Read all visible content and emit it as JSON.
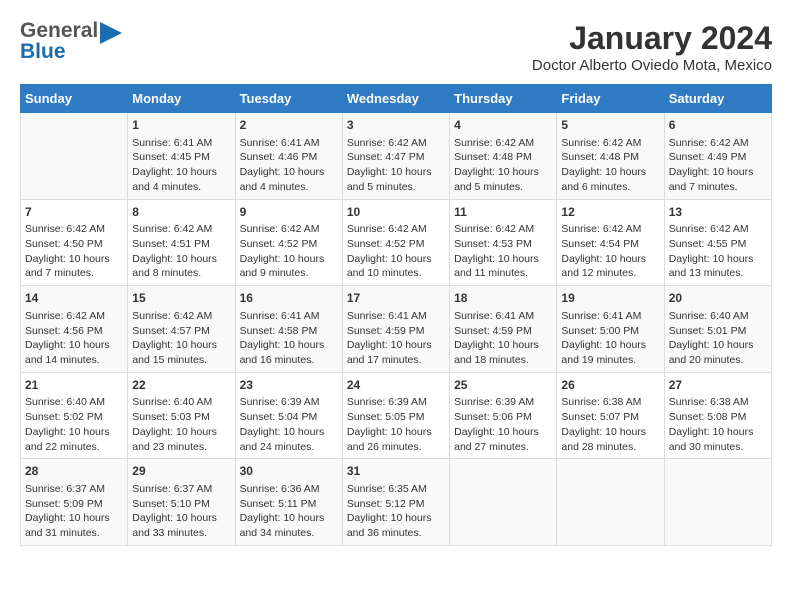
{
  "header": {
    "logo_general": "General",
    "logo_blue": "Blue",
    "title": "January 2024",
    "subtitle": "Doctor Alberto Oviedo Mota, Mexico"
  },
  "days_header": [
    "Sunday",
    "Monday",
    "Tuesday",
    "Wednesday",
    "Thursday",
    "Friday",
    "Saturday"
  ],
  "weeks": [
    [
      {
        "day": "",
        "sunrise": "",
        "sunset": "",
        "daylight": ""
      },
      {
        "day": "1",
        "sunrise": "Sunrise: 6:41 AM",
        "sunset": "Sunset: 4:45 PM",
        "daylight": "Daylight: 10 hours and 4 minutes."
      },
      {
        "day": "2",
        "sunrise": "Sunrise: 6:41 AM",
        "sunset": "Sunset: 4:46 PM",
        "daylight": "Daylight: 10 hours and 4 minutes."
      },
      {
        "day": "3",
        "sunrise": "Sunrise: 6:42 AM",
        "sunset": "Sunset: 4:47 PM",
        "daylight": "Daylight: 10 hours and 5 minutes."
      },
      {
        "day": "4",
        "sunrise": "Sunrise: 6:42 AM",
        "sunset": "Sunset: 4:48 PM",
        "daylight": "Daylight: 10 hours and 5 minutes."
      },
      {
        "day": "5",
        "sunrise": "Sunrise: 6:42 AM",
        "sunset": "Sunset: 4:48 PM",
        "daylight": "Daylight: 10 hours and 6 minutes."
      },
      {
        "day": "6",
        "sunrise": "Sunrise: 6:42 AM",
        "sunset": "Sunset: 4:49 PM",
        "daylight": "Daylight: 10 hours and 7 minutes."
      }
    ],
    [
      {
        "day": "7",
        "sunrise": "Sunrise: 6:42 AM",
        "sunset": "Sunset: 4:50 PM",
        "daylight": "Daylight: 10 hours and 7 minutes."
      },
      {
        "day": "8",
        "sunrise": "Sunrise: 6:42 AM",
        "sunset": "Sunset: 4:51 PM",
        "daylight": "Daylight: 10 hours and 8 minutes."
      },
      {
        "day": "9",
        "sunrise": "Sunrise: 6:42 AM",
        "sunset": "Sunset: 4:52 PM",
        "daylight": "Daylight: 10 hours and 9 minutes."
      },
      {
        "day": "10",
        "sunrise": "Sunrise: 6:42 AM",
        "sunset": "Sunset: 4:52 PM",
        "daylight": "Daylight: 10 hours and 10 minutes."
      },
      {
        "day": "11",
        "sunrise": "Sunrise: 6:42 AM",
        "sunset": "Sunset: 4:53 PM",
        "daylight": "Daylight: 10 hours and 11 minutes."
      },
      {
        "day": "12",
        "sunrise": "Sunrise: 6:42 AM",
        "sunset": "Sunset: 4:54 PM",
        "daylight": "Daylight: 10 hours and 12 minutes."
      },
      {
        "day": "13",
        "sunrise": "Sunrise: 6:42 AM",
        "sunset": "Sunset: 4:55 PM",
        "daylight": "Daylight: 10 hours and 13 minutes."
      }
    ],
    [
      {
        "day": "14",
        "sunrise": "Sunrise: 6:42 AM",
        "sunset": "Sunset: 4:56 PM",
        "daylight": "Daylight: 10 hours and 14 minutes."
      },
      {
        "day": "15",
        "sunrise": "Sunrise: 6:42 AM",
        "sunset": "Sunset: 4:57 PM",
        "daylight": "Daylight: 10 hours and 15 minutes."
      },
      {
        "day": "16",
        "sunrise": "Sunrise: 6:41 AM",
        "sunset": "Sunset: 4:58 PM",
        "daylight": "Daylight: 10 hours and 16 minutes."
      },
      {
        "day": "17",
        "sunrise": "Sunrise: 6:41 AM",
        "sunset": "Sunset: 4:59 PM",
        "daylight": "Daylight: 10 hours and 17 minutes."
      },
      {
        "day": "18",
        "sunrise": "Sunrise: 6:41 AM",
        "sunset": "Sunset: 4:59 PM",
        "daylight": "Daylight: 10 hours and 18 minutes."
      },
      {
        "day": "19",
        "sunrise": "Sunrise: 6:41 AM",
        "sunset": "Sunset: 5:00 PM",
        "daylight": "Daylight: 10 hours and 19 minutes."
      },
      {
        "day": "20",
        "sunrise": "Sunrise: 6:40 AM",
        "sunset": "Sunset: 5:01 PM",
        "daylight": "Daylight: 10 hours and 20 minutes."
      }
    ],
    [
      {
        "day": "21",
        "sunrise": "Sunrise: 6:40 AM",
        "sunset": "Sunset: 5:02 PM",
        "daylight": "Daylight: 10 hours and 22 minutes."
      },
      {
        "day": "22",
        "sunrise": "Sunrise: 6:40 AM",
        "sunset": "Sunset: 5:03 PM",
        "daylight": "Daylight: 10 hours and 23 minutes."
      },
      {
        "day": "23",
        "sunrise": "Sunrise: 6:39 AM",
        "sunset": "Sunset: 5:04 PM",
        "daylight": "Daylight: 10 hours and 24 minutes."
      },
      {
        "day": "24",
        "sunrise": "Sunrise: 6:39 AM",
        "sunset": "Sunset: 5:05 PM",
        "daylight": "Daylight: 10 hours and 26 minutes."
      },
      {
        "day": "25",
        "sunrise": "Sunrise: 6:39 AM",
        "sunset": "Sunset: 5:06 PM",
        "daylight": "Daylight: 10 hours and 27 minutes."
      },
      {
        "day": "26",
        "sunrise": "Sunrise: 6:38 AM",
        "sunset": "Sunset: 5:07 PM",
        "daylight": "Daylight: 10 hours and 28 minutes."
      },
      {
        "day": "27",
        "sunrise": "Sunrise: 6:38 AM",
        "sunset": "Sunset: 5:08 PM",
        "daylight": "Daylight: 10 hours and 30 minutes."
      }
    ],
    [
      {
        "day": "28",
        "sunrise": "Sunrise: 6:37 AM",
        "sunset": "Sunset: 5:09 PM",
        "daylight": "Daylight: 10 hours and 31 minutes."
      },
      {
        "day": "29",
        "sunrise": "Sunrise: 6:37 AM",
        "sunset": "Sunset: 5:10 PM",
        "daylight": "Daylight: 10 hours and 33 minutes."
      },
      {
        "day": "30",
        "sunrise": "Sunrise: 6:36 AM",
        "sunset": "Sunset: 5:11 PM",
        "daylight": "Daylight: 10 hours and 34 minutes."
      },
      {
        "day": "31",
        "sunrise": "Sunrise: 6:35 AM",
        "sunset": "Sunset: 5:12 PM",
        "daylight": "Daylight: 10 hours and 36 minutes."
      },
      {
        "day": "",
        "sunrise": "",
        "sunset": "",
        "daylight": ""
      },
      {
        "day": "",
        "sunrise": "",
        "sunset": "",
        "daylight": ""
      },
      {
        "day": "",
        "sunrise": "",
        "sunset": "",
        "daylight": ""
      }
    ]
  ]
}
